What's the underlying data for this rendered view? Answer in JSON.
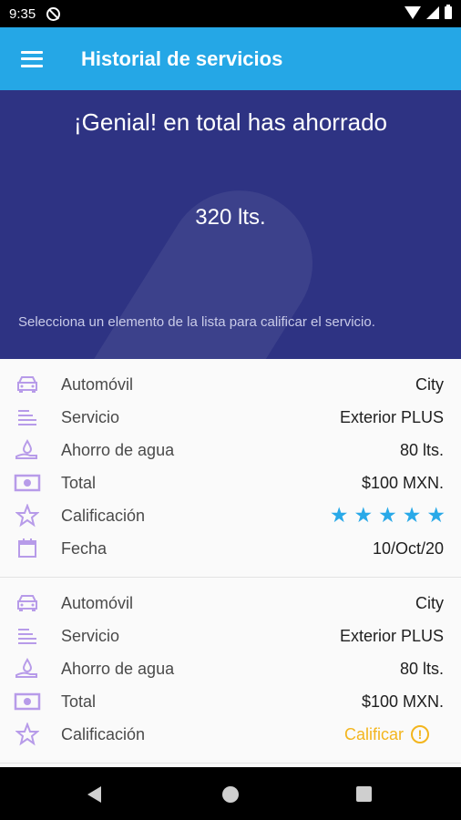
{
  "status_bar": {
    "time": "9:35"
  },
  "app_bar": {
    "title": "Historial de servicios"
  },
  "summary": {
    "heading": "¡Genial! en total has ahorrado",
    "amount": "320 lts.",
    "hint": "Selecciona un elemento de la lista para calificar el servicio."
  },
  "services": [
    {
      "car_label": "Automóvil",
      "car": "City",
      "service_label": "Servicio",
      "service": "Exterior PLUS",
      "water_label": "Ahorro de agua",
      "water": "80 lts.",
      "total_label": "Total",
      "total": "$100 MXN.",
      "rating_label": "Calificación",
      "rating": 5,
      "date_label": "Fecha",
      "date": "10/Oct/20"
    },
    {
      "car_label": "Automóvil",
      "car": "City",
      "service_label": "Servicio",
      "service": "Exterior PLUS",
      "water_label": "Ahorro de agua",
      "water": "80 lts.",
      "total_label": "Total",
      "total": "$100 MXN.",
      "rating_label": "Calificación",
      "rate_action": "Calificar"
    }
  ],
  "icons": {
    "menu": "hamburger-menu-icon",
    "car": "car-icon",
    "service": "list-lines-icon",
    "water": "water-drop-hand-icon",
    "total": "banknote-icon",
    "rating": "star-outline-icon",
    "date": "calendar-icon",
    "alert": "exclamation-circle-icon"
  },
  "colors": {
    "app_bar": "#25a7e6",
    "hero": "#2e3383",
    "icon_purple": "#b79be9",
    "star_blue": "#29a9e8",
    "action_amber": "#f3b51d"
  }
}
